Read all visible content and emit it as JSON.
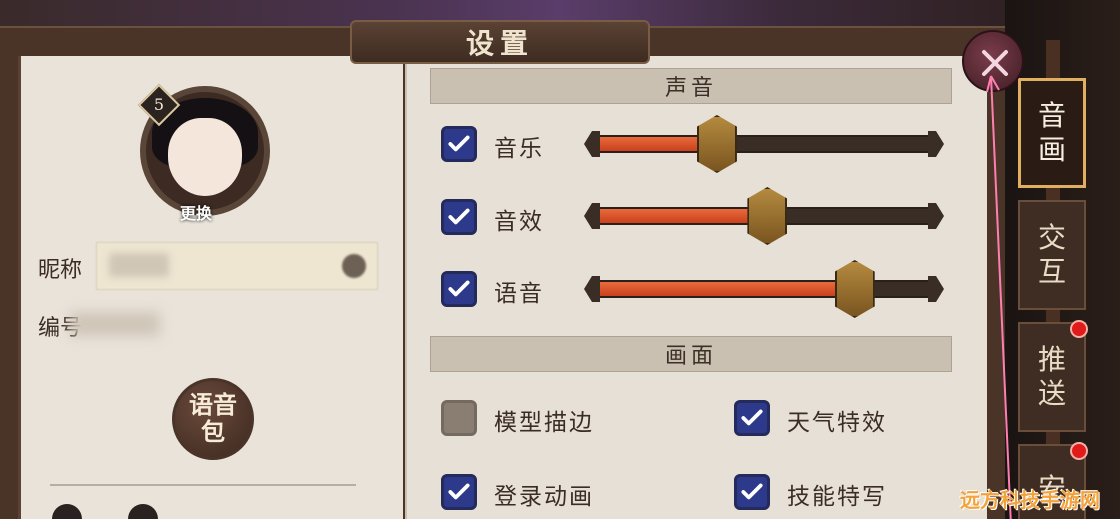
{
  "title": "设置",
  "profile": {
    "level": "5",
    "change_label": "更换",
    "nickname_label": "昵称",
    "id_label": "编号",
    "voice_pack_line1": "语音",
    "voice_pack_line2": "包"
  },
  "sections": {
    "sound": "声音",
    "graphics": "画面"
  },
  "sound_options": [
    {
      "label": "音乐",
      "checked": true,
      "level": 0.36
    },
    {
      "label": "音效",
      "checked": true,
      "level": 0.51
    },
    {
      "label": "语音",
      "checked": true,
      "level": 0.77
    }
  ],
  "graphics_options": [
    {
      "label": "模型描边",
      "checked": false
    },
    {
      "label": "天气特效",
      "checked": true
    },
    {
      "label": "登录动画",
      "checked": true
    },
    {
      "label": "技能特写",
      "checked": true
    }
  ],
  "side_tabs": [
    {
      "line1": "音",
      "line2": "画",
      "active": true,
      "badge": false
    },
    {
      "line1": "交",
      "line2": "互",
      "active": false,
      "badge": false
    },
    {
      "line1": "推",
      "line2": "送",
      "active": false,
      "badge": true
    },
    {
      "line1": "安",
      "line2": "",
      "active": false,
      "badge": true
    }
  ],
  "icons": {
    "close": "close-icon",
    "check": "check-icon"
  },
  "colors": {
    "checkbox_on": "#2d3a8c",
    "slider_fill": "#e05a2e",
    "active_tab_border": "#e0b060",
    "badge": "#e11a1a"
  },
  "watermark": "远方科技手游网"
}
